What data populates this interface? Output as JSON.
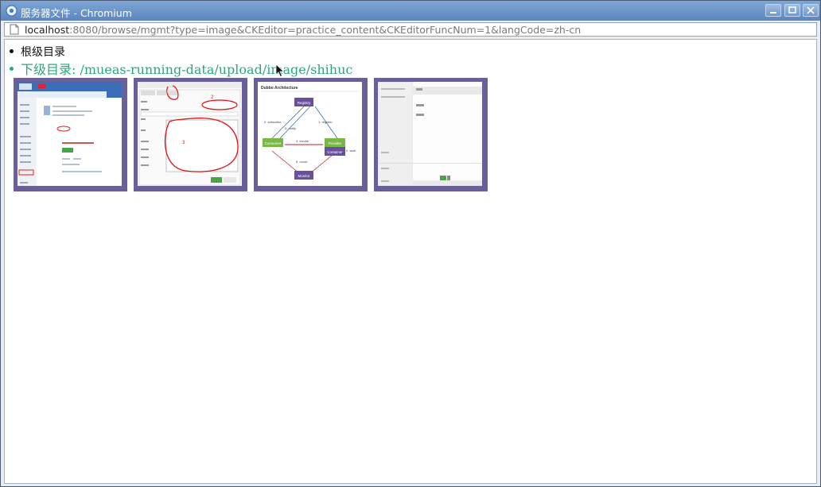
{
  "window": {
    "title": "服务器文件 - Chromium"
  },
  "address_bar": {
    "host": "localhost",
    "path": ":8080/browse/mgmt?type=image&CKEditor=practice_content&CKEditorFuncNum=1&langCode=zh-cn"
  },
  "listing": {
    "root_label": "根级目录",
    "sub_label": "下级目录: /mueas-running-data/upload/image/shihuc"
  },
  "thumbnails": {
    "thumb3": {
      "title": "Dubbo Architecture",
      "registry": "Registry",
      "consumer": "Consumer",
      "provider": "Provider",
      "container": "Container",
      "monitor": "Monitor",
      "e_subscribe": "2. subscribe",
      "e_notify": "3. notify",
      "e_register": "1. register",
      "e_invoke": "4. invoke",
      "e_count": "5. count",
      "e_start": "0. start"
    }
  },
  "colors": {
    "thumb_border": "#6a5f98",
    "link_green": "#2aa87a",
    "titlebar": "#5b86bf"
  }
}
